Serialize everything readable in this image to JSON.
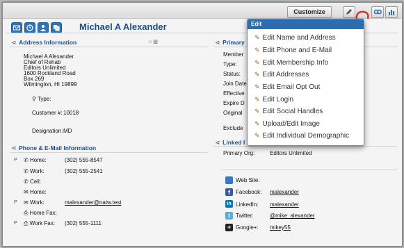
{
  "toolbar": {
    "customize_label": "Customize",
    "buttons": [
      {
        "icon": "pencil-icon"
      },
      {
        "icon": "link-icon"
      },
      {
        "icon": "bar-chart-icon"
      }
    ]
  },
  "header": {
    "icons": [
      "email-icon",
      "clock-icon",
      "user-upload-icon",
      "copy-icon"
    ],
    "name": "Michael A Alexander"
  },
  "address": {
    "title": "Address Information",
    "lines": [
      "Michael A Alexander",
      "Chief of Rehab",
      "Editors Unlimited",
      "1600 Rockland Road",
      "Box 269",
      "Wilmington, HI 19899"
    ],
    "type_label": "Type:",
    "customer_label": "Customer #:",
    "customer_value": "10018",
    "designation_label": "Designation:",
    "designation_value": "MD"
  },
  "phone": {
    "title": "Phone & E-Mail Information",
    "rows": [
      {
        "prefix": "P",
        "label": "Home:",
        "value": "(302) 555-8547"
      },
      {
        "prefix": "",
        "label": "Work:",
        "value": "(302) 555-2541"
      },
      {
        "prefix": "",
        "label": "Cell:",
        "value": ""
      },
      {
        "prefix": "",
        "label": "Home:",
        "value": ""
      },
      {
        "prefix": "P",
        "label": "Work:",
        "value": "malexander@natw.test"
      },
      {
        "prefix": "",
        "label": "Home Fax:",
        "value": ""
      },
      {
        "prefix": "P",
        "label": "Work Fax:",
        "value": "(302) 555-1111"
      }
    ]
  },
  "membership": {
    "title": "Primary",
    "labels": [
      "Member",
      "Type:",
      "Status:",
      "Join Date",
      "Effective",
      "Expire D",
      "Original",
      "Exclude"
    ]
  },
  "linked": {
    "title": "Linked I",
    "primary_org_label": "Primary Org:",
    "primary_org_value": "Editors Unlimited"
  },
  "social": {
    "rows": [
      {
        "icon": "website-icon",
        "label": "Web Site:",
        "value": "",
        "color": "#3a78c2"
      },
      {
        "icon": "facebook-icon",
        "label": "Facebook:",
        "value": "malexander",
        "color": "#3b5998"
      },
      {
        "icon": "linkedin-icon",
        "label": "LinkedIn:",
        "value": "malexander",
        "color": "#0e76a8"
      },
      {
        "icon": "twitter-icon",
        "label": "Twitter:",
        "value": "@mike_alexander",
        "color": "#5ea9dd"
      },
      {
        "icon": "google-plus-icon",
        "label": "Google+:",
        "value": "mikey55",
        "color": "#222222"
      }
    ]
  },
  "edit_menu": {
    "title": "Edit",
    "items": [
      "Edit Name and Address",
      "Edit Phone and E-Mail",
      "Edit Membership Info",
      "Edit Addresses",
      "Edit Email Opt Out",
      "Edit Login",
      "Edit Social Handles",
      "Upload/Edit Image",
      "Edit Individual Demographic"
    ]
  }
}
